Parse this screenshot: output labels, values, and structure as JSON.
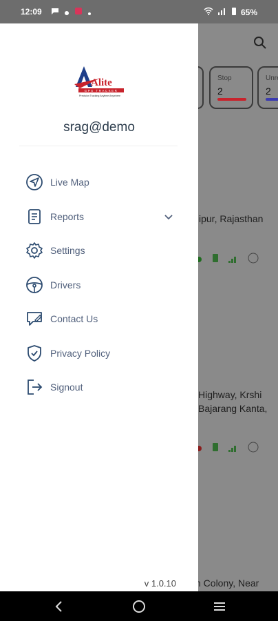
{
  "status_bar": {
    "time": "12:09",
    "battery": "65%"
  },
  "drawer": {
    "logo_text": "Alite",
    "logo_subtext": "GPS TRACKER",
    "logo_tagline": "Precision Tracking Anytime Anywhere",
    "username": "srag@demo",
    "menu": [
      {
        "label": "Live Map",
        "icon": "navigation-icon"
      },
      {
        "label": "Reports",
        "icon": "report-icon",
        "expandable": true
      },
      {
        "label": "Settings",
        "icon": "settings-icon"
      },
      {
        "label": "Drivers",
        "icon": "steering-wheel-icon"
      },
      {
        "label": "Contact Us",
        "icon": "contact-icon"
      },
      {
        "label": "Privacy Policy",
        "icon": "shield-icon"
      },
      {
        "label": "Signout",
        "icon": "signout-icon"
      }
    ],
    "version": "v 1.0.10"
  },
  "background": {
    "cards": [
      {
        "title": "",
        "count": "",
        "color": "#3a3a3a"
      },
      {
        "title": "Stop",
        "count": "2",
        "color": "#c8232c"
      },
      {
        "title": "Unre",
        "count": "2",
        "color": "#3b3bb0"
      }
    ],
    "texts": [
      "ipur, Rajasthan",
      "Highway, Krshi",
      "Bajarang Kanta,",
      "h Colony, Near"
    ]
  },
  "colors": {
    "scrim": "#8a8a8a",
    "drawer_bg": "#ffffff",
    "menu_text": "#51607c",
    "icon": "#2b4a6f",
    "accent_red": "#c8232c",
    "accent_blue": "#1f3f8a"
  }
}
